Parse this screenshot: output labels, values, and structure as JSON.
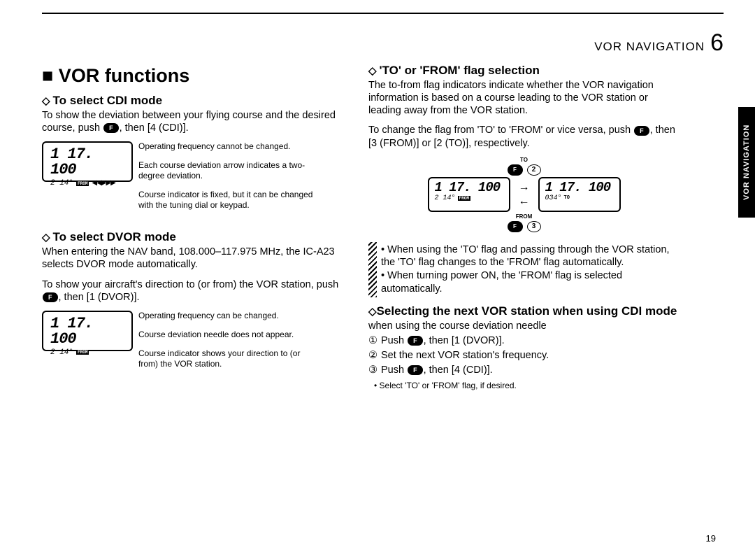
{
  "header": {
    "section": "VOR NAVIGATION",
    "chapter_num": "6",
    "side_tab": "VOR NAVIGATION"
  },
  "page_num": "19",
  "title": "■ VOR functions",
  "cdi": {
    "heading": "To select CDI mode",
    "para": "To show the deviation between your flying course and the desired course, push ",
    "para2": ", then [4 (CDI)].",
    "lcd": {
      "freq": "1 17. 100",
      "course": "2 14°",
      "from": "FROM",
      "arrows": "◀◀▶▶▶"
    },
    "callouts": {
      "c1": "Operating frequency cannot be changed.",
      "c2": "Each course deviation arrow indicates a two-degree deviation.",
      "c3": "Course indicator is fixed, but it can be changed with the tuning dial or keypad."
    }
  },
  "dvor": {
    "heading": "To select DVOR mode",
    "para1": "When entering the NAV band, 108.000–117.975 MHz, the IC-A23 selects DVOR mode automatically.",
    "para2a": "To show your aircraft's direction to (or from) the VOR station, push ",
    "para2b": ", then [1 (DVOR)].",
    "lcd": {
      "freq": "1 17. 100",
      "course": "2 14°",
      "from": "FROM"
    },
    "callouts": {
      "c1": "Operating frequency can be changed.",
      "c2": "Course deviation needle does not appear.",
      "c3": "Course indicator shows your direction to (or from) the VOR station."
    }
  },
  "tofrom": {
    "heading": "'TO' or 'FROM' flag selection",
    "para1": "The to-from flag indicators indicate whether the VOR navigation information is based on a course leading to the VOR station or leading away from the VOR station.",
    "para2a": "To change the flag from 'TO' to 'FROM' or vice versa, push ",
    "para2b": ", then [3 (FROM)] or [2 (TO)], respectively.",
    "diagram": {
      "to_label": "TO",
      "from_label": "FROM",
      "key_f": "F",
      "key_2": "2",
      "key_3": "3",
      "left": {
        "freq": "1 17. 100",
        "course": "2 14°",
        "badge": "FROM"
      },
      "right": {
        "freq": "1 17. 100",
        "course": "034°",
        "badge": "TO"
      }
    },
    "note1": "• When using the 'TO' flag and passing through the VOR station, the 'TO' flag changes to the 'FROM' flag automatically.",
    "note2": "• When turning power ON, the 'FROM' flag is selected automatically."
  },
  "nextvor": {
    "heading": "Selecting the next VOR station when using CDI mode",
    "heading_sub": " when using the course deviation needle",
    "step1a": "Push ",
    "step1b": ", then [1 (DVOR)].",
    "step2": "Set the next VOR station's frequency.",
    "step3a": "Push ",
    "step3b": ", then [4 (CDI)].",
    "bullet": "• Select 'TO' or 'FROM' flag, if desired."
  },
  "fkey": "F"
}
